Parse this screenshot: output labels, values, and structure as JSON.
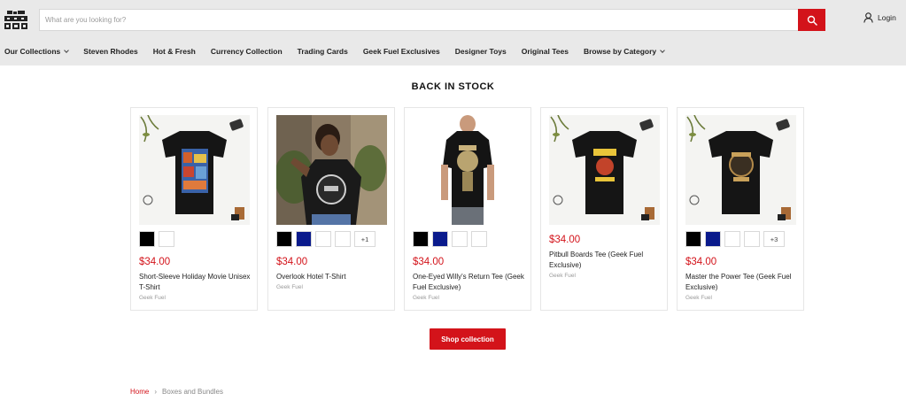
{
  "header": {
    "search": {
      "placeholder": "What are you looking for?"
    },
    "login_label": "Login",
    "icons": [
      "logo",
      "search-icon",
      "user-icon"
    ]
  },
  "nav": {
    "items": [
      {
        "label": "Our Collections",
        "dropdown": true
      },
      {
        "label": "Steven Rhodes"
      },
      {
        "label": "Hot & Fresh"
      },
      {
        "label": "Currency Collection"
      },
      {
        "label": "Trading Cards"
      },
      {
        "label": "Geek Fuel Exclusives"
      },
      {
        "label": "Designer Toys"
      },
      {
        "label": "Original Tees"
      },
      {
        "label": "Browse by Category",
        "dropdown": true
      }
    ]
  },
  "section": {
    "title": "BACK IN STOCK"
  },
  "products": [
    {
      "price": "$34.00",
      "title": "Short-Sleeve Holiday Movie Unisex T-Shirt",
      "vendor": "Geek Fuel",
      "swatches": [
        "#000000",
        "#ffffff"
      ],
      "more": ""
    },
    {
      "price": "$34.00",
      "title": "Overlook Hotel T-Shirt",
      "vendor": "Geek Fuel",
      "swatches": [
        "#000000",
        "#0a1a8c",
        "#ffffff",
        "#ffffff"
      ],
      "more": "+1"
    },
    {
      "price": "$34.00",
      "title": "One-Eyed Willy's Return Tee (Geek Fuel Exclusive)",
      "vendor": "Geek Fuel",
      "swatches": [
        "#000000",
        "#0a1a8c",
        "#ffffff",
        "#ffffff"
      ],
      "more": ""
    },
    {
      "price": "$34.00",
      "title": "Pitbull Boards Tee (Geek Fuel Exclusive)",
      "vendor": "Geek Fuel",
      "swatches": [],
      "more": ""
    },
    {
      "price": "$34.00",
      "title": "Master the Power Tee (Geek Fuel Exclusive)",
      "vendor": "Geek Fuel",
      "swatches": [
        "#000000",
        "#0a1a8c",
        "#ffffff",
        "#ffffff"
      ],
      "more": "+3"
    }
  ],
  "cta": {
    "label": "Shop collection"
  },
  "breadcrumb": {
    "home": "Home",
    "separator": "›",
    "current": "Boxes and Bundles"
  },
  "colors": {
    "accent": "#d3131a",
    "header_bg": "#e9e9e9"
  }
}
